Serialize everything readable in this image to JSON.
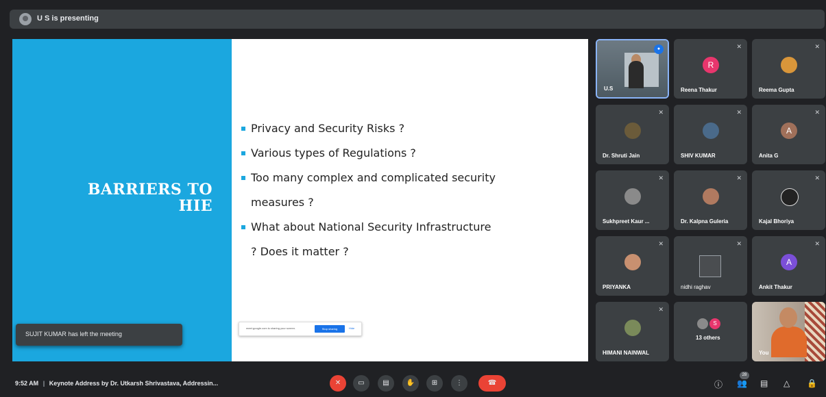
{
  "topbar": {
    "presenting": "U S is presenting"
  },
  "slide": {
    "title_line1": "BARRIERS TO",
    "title_line2": "HIE",
    "bullets": [
      "Privacy and Security Risks ?",
      "Various types of Regulations ?",
      "Too many complex and complicated security",
      "measures ?",
      "What about National Security Infrastructure",
      "? Does it matter ?"
    ],
    "accent": "#1ba7df"
  },
  "toast": "SUJIT KUMAR has left the meeting",
  "sharebar": {
    "message": "meet.google.com is sharing your screen.",
    "stop": "Stop sharing",
    "hide": "Hide"
  },
  "participants": [
    {
      "name": "U.S",
      "type": "video"
    },
    {
      "name": "Reena Thakur",
      "initial": "R",
      "color": "#e8366d"
    },
    {
      "name": "Reema Gupta",
      "type": "photo",
      "color": "#d9963a"
    },
    {
      "name": "Dr. Shruti Jain",
      "type": "photo",
      "color": "#6b5b3a"
    },
    {
      "name": "SHIV KUMAR",
      "type": "photo",
      "color": "#4a6a8a"
    },
    {
      "name": "Anita G",
      "initial": "A",
      "color": "#a0705a"
    },
    {
      "name": "Sukhpreet Kaur ...",
      "type": "photo",
      "color": "#8a8a8a"
    },
    {
      "name": "Dr. Kalpna Guleria",
      "type": "photo",
      "color": "#b07a60"
    },
    {
      "name": "Kajal Bhoriya",
      "type": "photo",
      "color": "#222222"
    },
    {
      "name": "PRIYANKA",
      "type": "photo",
      "color": "#c89070"
    },
    {
      "name": "nidhi raghav",
      "type": "broken"
    },
    {
      "name": "Ankit Thakur",
      "initial": "A",
      "color": "#7b4fd8"
    },
    {
      "name": "HIMANI NAINWAL",
      "type": "photo",
      "color": "#7a8a5a"
    },
    {
      "name": "13 others",
      "type": "others",
      "initial": "S",
      "color": "#e8366d"
    },
    {
      "name": "You",
      "type": "self"
    }
  ],
  "bottom": {
    "time": "9:52 AM",
    "separator": "|",
    "title": "Keynote Address by Dr. Utkarsh Shrivastava, Addressin...",
    "participant_count": "28"
  }
}
